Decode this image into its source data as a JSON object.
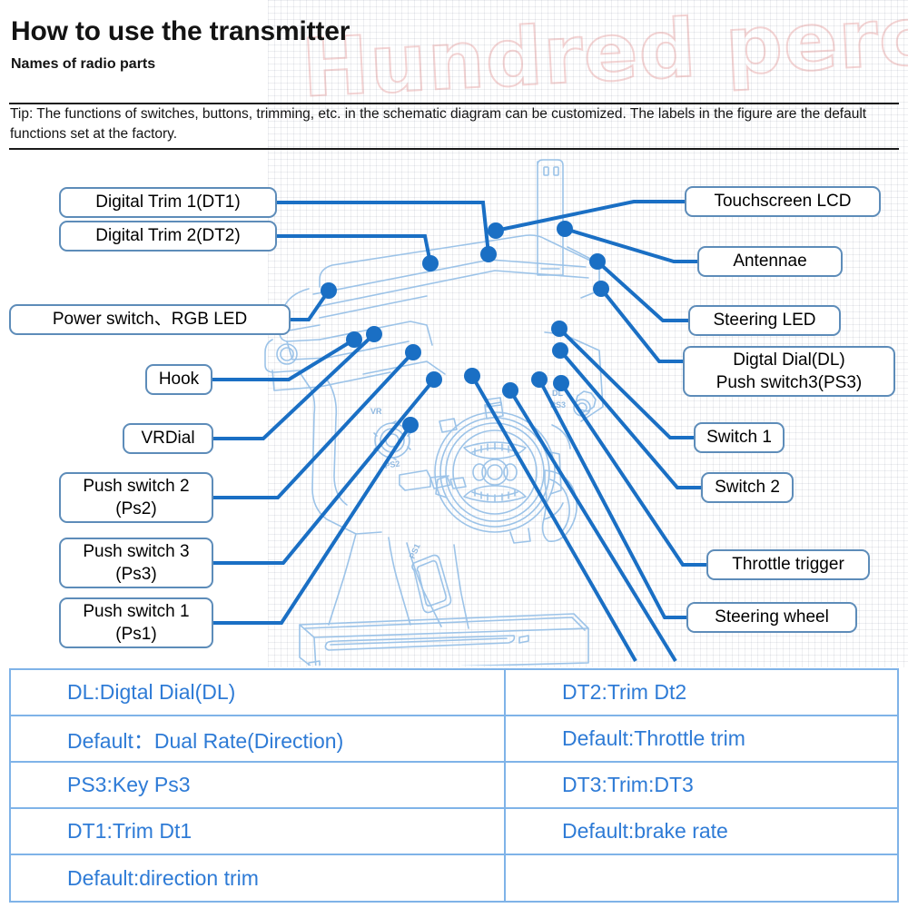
{
  "header": {
    "title": "How to use the transmitter",
    "subtitle": "Names of radio parts",
    "tip": "Tip: The functions of switches, buttons, trimming, etc. in the schematic diagram can be customized. The labels in the figure are the default functions set at the factory."
  },
  "watermark": {
    "text": "Hundred percent"
  },
  "colors": {
    "callout_border": "#5d8cb9",
    "leader_line": "#1a6fc4",
    "device_outline": "#9cc3e8",
    "table_border": "#7fb3e8",
    "table_text": "#2e7bd6",
    "watermark": "#e29696"
  },
  "diagram": {
    "device_labels": [
      {
        "name": "vr-dial-marking",
        "text": "VR"
      },
      {
        "name": "ps2-marking",
        "text": "PS2"
      },
      {
        "name": "ps1-marking",
        "text": "PS1"
      },
      {
        "name": "dl-marking",
        "text": "DL"
      },
      {
        "name": "ps3-marking",
        "text": "PS3"
      }
    ],
    "callouts_left": [
      {
        "name": "digital-trim-1",
        "text": "Digital Trim 1(DT1)"
      },
      {
        "name": "digital-trim-2",
        "text": "Digital Trim 2(DT2)"
      },
      {
        "name": "power-switch-rgb-led",
        "text": "Power switch、RGB LED"
      },
      {
        "name": "hook",
        "text": "Hook"
      },
      {
        "name": "vr-dial",
        "text": "VRDial"
      },
      {
        "name": "push-switch-2",
        "text": "Push switch 2\n(Ps2)"
      },
      {
        "name": "push-switch-3",
        "text": "Push switch 3\n(Ps3)"
      },
      {
        "name": "push-switch-1",
        "text": "Push switch 1\n(Ps1)"
      }
    ],
    "callouts_right": [
      {
        "name": "touchscreen-lcd",
        "text": "Touchscreen LCD"
      },
      {
        "name": "antennae",
        "text": "Antennae"
      },
      {
        "name": "steering-led",
        "text": "Steering LED"
      },
      {
        "name": "digital-dial-push-switch-3",
        "text": "Digtal Dial(DL)\nPush switch3(PS3)"
      },
      {
        "name": "switch-1",
        "text": "Switch 1"
      },
      {
        "name": "switch-2",
        "text": "Switch 2"
      },
      {
        "name": "throttle-trigger",
        "text": "Throttle trigger"
      },
      {
        "name": "steering-wheel",
        "text": "Steering wheel"
      }
    ]
  },
  "legend_table": {
    "rows": [
      {
        "left": "DL:Digtal Dial(DL)",
        "right": "DT2:Trim Dt2"
      },
      {
        "left": "Default：Dual Rate(Direction)",
        "right": "Default:Throttle trim"
      },
      {
        "left": "PS3:Key Ps3",
        "right": "DT3:Trim:DT3"
      },
      {
        "left": "DT1:Trim Dt1",
        "right": "Default:brake rate"
      },
      {
        "left": "Default:direction trim",
        "right": ""
      }
    ]
  }
}
